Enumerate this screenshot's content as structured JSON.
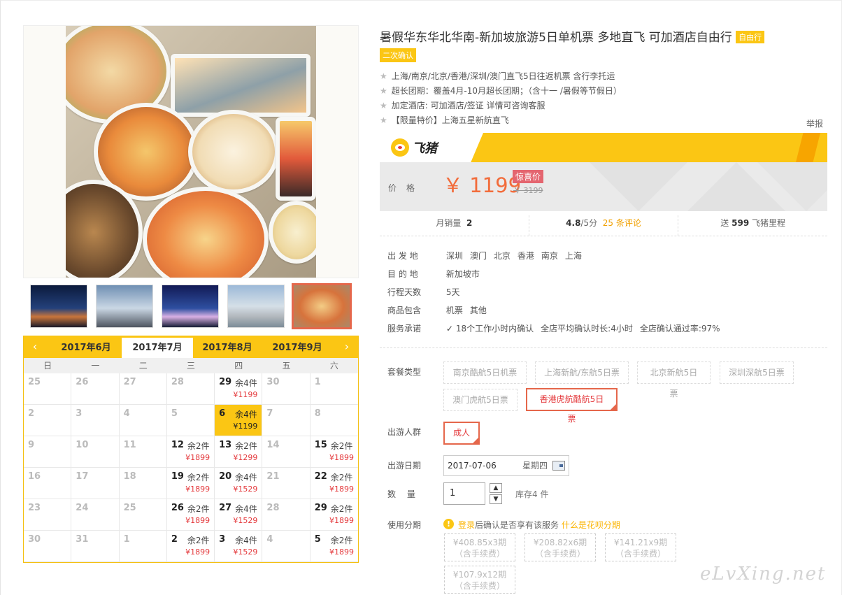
{
  "product": {
    "title": "暑假华东华北华南-新加坡旅游5日单机票 多地直飞 可加酒店自由行",
    "tag_free": "自由行",
    "tag_confirm": "二次确认",
    "features": [
      "上海/南京/北京/香港/深圳/澳门直飞5日往返机票 含行李托运",
      "超长团期：覆盖4月-10月超长团期；（含十一 /暑假等节假日）",
      "加定酒店: 可加酒店/签证 详情可咨询客服",
      "【限量特价】上海五星新航直飞"
    ],
    "report": "举报"
  },
  "brand": {
    "logo_text": "飞猪",
    "icon": "fliggy-pig-icon",
    "accent": "#fbc614"
  },
  "price": {
    "label": "价格",
    "current": "￥ 1199",
    "badge": "惊喜价",
    "original": "￥ 3199"
  },
  "stats": {
    "monthly_sales_label": "月销量",
    "monthly_sales": "2",
    "rating": "4.8",
    "rating_suffix": "/5分",
    "reviews": "25 条评论",
    "mileage_prefix": "送",
    "mileage": "599",
    "mileage_suffix": "飞猪里程"
  },
  "info": [
    {
      "label": "出 发 地",
      "values": [
        "深圳",
        "澳门",
        "北京",
        "香港",
        "南京",
        "上海"
      ]
    },
    {
      "label": "目 的 地",
      "values": [
        "新加坡市"
      ]
    },
    {
      "label": "行程天数",
      "values": [
        "5天"
      ]
    },
    {
      "label": "商品包含",
      "values": [
        "机票",
        "其他"
      ]
    },
    {
      "label": "服务承诺",
      "values": [
        "18个工作小时内确认",
        "全店平均确认时长:4小时",
        "全店确认通过率:97%"
      ]
    }
  ],
  "options": {
    "package_label": "套餐类型",
    "packages": [
      "南京酷航5日机票",
      "上海新航/东航5日票",
      "北京新航5日票",
      "深圳深航5日票",
      "澳门虎航5日票",
      "香港虎航酷航5日票"
    ],
    "package_selected": 5,
    "group_label": "出游人群",
    "group": "成人",
    "date_label": "出游日期",
    "date": "2017-07-06",
    "weekday": "星期四",
    "qty_label": "数　量",
    "qty": "1",
    "stock": "库存4 件",
    "installment_label": "使用分期",
    "login_link": "登录",
    "installment_note": "后确认是否享有该服务",
    "installment_link": "什么是花呗分期",
    "installments": [
      {
        "amount": "¥408.85x3期",
        "fee": "（含手续费）"
      },
      {
        "amount": "¥208.82x6期",
        "fee": "（含手续费）"
      },
      {
        "amount": "¥141.21x9期",
        "fee": "（含手续费）"
      },
      {
        "amount": "¥107.9x12期",
        "fee": "（含手续费）"
      }
    ]
  },
  "calendar": {
    "months": [
      "2017年6月",
      "2017年7月",
      "2017年8月",
      "2017年9月"
    ],
    "active_month": 1,
    "weekdays": [
      "日",
      "一",
      "二",
      "三",
      "四",
      "五",
      "六"
    ],
    "cells": [
      {
        "d": "25"
      },
      {
        "d": "26"
      },
      {
        "d": "27"
      },
      {
        "d": "28"
      },
      {
        "d": "29",
        "stock": "余4件",
        "price": "¥1199"
      },
      {
        "d": "30"
      },
      {
        "d": "1"
      },
      {
        "d": "2"
      },
      {
        "d": "3"
      },
      {
        "d": "4"
      },
      {
        "d": "5"
      },
      {
        "d": "6",
        "stock": "余4件",
        "price": "¥1199",
        "selected": true
      },
      {
        "d": "7"
      },
      {
        "d": "8"
      },
      {
        "d": "9"
      },
      {
        "d": "10"
      },
      {
        "d": "11"
      },
      {
        "d": "12",
        "stock": "余2件",
        "price": "¥1899"
      },
      {
        "d": "13",
        "stock": "余2件",
        "price": "¥1299"
      },
      {
        "d": "14"
      },
      {
        "d": "15",
        "stock": "余2件",
        "price": "¥1899"
      },
      {
        "d": "16"
      },
      {
        "d": "17"
      },
      {
        "d": "18"
      },
      {
        "d": "19",
        "stock": "余2件",
        "price": "¥1899"
      },
      {
        "d": "20",
        "stock": "余4件",
        "price": "¥1529"
      },
      {
        "d": "21"
      },
      {
        "d": "22",
        "stock": "余2件",
        "price": "¥1899"
      },
      {
        "d": "23"
      },
      {
        "d": "24"
      },
      {
        "d": "25"
      },
      {
        "d": "26",
        "stock": "余2件",
        "price": "¥1899"
      },
      {
        "d": "27",
        "stock": "余4件",
        "price": "¥1529"
      },
      {
        "d": "28"
      },
      {
        "d": "29",
        "stock": "余2件",
        "price": "¥1899"
      },
      {
        "d": "30"
      },
      {
        "d": "31"
      },
      {
        "d": "1"
      },
      {
        "d": "2",
        "stock": "余2件",
        "price": "¥1899"
      },
      {
        "d": "3",
        "stock": "余4件",
        "price": "¥1529"
      },
      {
        "d": "4"
      },
      {
        "d": "5",
        "stock": "余2件",
        "price": "¥1899"
      }
    ]
  },
  "watermark": "eLvXing.net"
}
